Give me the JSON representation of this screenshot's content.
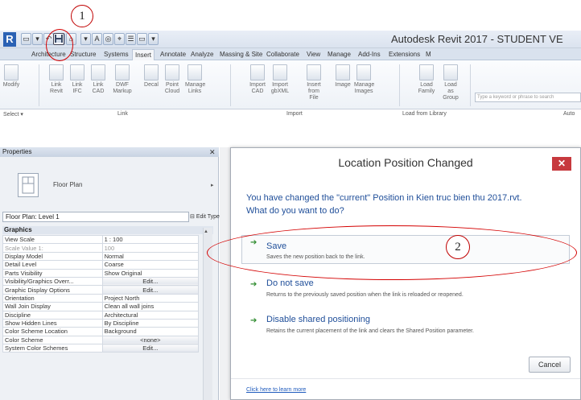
{
  "callouts": {
    "one": "1",
    "two": "2"
  },
  "app": {
    "logo": "R",
    "title": "Autodesk Revit 2017 - STUDENT VE"
  },
  "qat": [
    "▭",
    "▾",
    "↶",
    "↷",
    "⌂",
    "▾",
    "A",
    "◎",
    "⌖",
    "☰",
    "▭",
    "▾"
  ],
  "tabs": [
    "Architecture",
    "Structure",
    "Systems",
    "Insert",
    "Annotate",
    "Analyze",
    "Massing & Site",
    "Collaborate",
    "View",
    "Manage",
    "Add-Ins",
    "Extensions",
    "M"
  ],
  "active_tab": "Insert",
  "ribbon": {
    "buttons": [
      "Modify",
      "Link Revit",
      "Link IFC",
      "Link CAD",
      "DWF Markup",
      "Decal",
      "Point Cloud",
      "Manage Links",
      "Import CAD",
      "Import gbXML",
      "Insert from File",
      "Image",
      "Manage Images",
      "Load Family",
      "Load as Group"
    ],
    "panels": {
      "select": "Select ▾",
      "link": "Link",
      "import": "Import",
      "load_from_library": "Load from Library",
      "autodesk": "Auto"
    },
    "search_placeholder": "Type a keyword or phrase to search"
  },
  "properties": {
    "header": "Properties",
    "close": "✕",
    "type_name": "Floor Plan",
    "instance": "Floor Plan: Level 1",
    "edit_type": "Edit Type",
    "group": "Graphics",
    "rows": [
      {
        "name": "View Scale",
        "value": "1 : 100",
        "button": false
      },
      {
        "name": "Scale Value 1:",
        "value": "100",
        "button": false,
        "dim": true
      },
      {
        "name": "Display Model",
        "value": "Normal",
        "button": false
      },
      {
        "name": "Detail Level",
        "value": "Coarse",
        "button": false
      },
      {
        "name": "Parts Visibility",
        "value": "Show Original",
        "button": false
      },
      {
        "name": "Visibility/Graphics Overr...",
        "value": "Edit...",
        "button": true
      },
      {
        "name": "Graphic Display Options",
        "value": "Edit...",
        "button": true
      },
      {
        "name": "Orientation",
        "value": "Project North",
        "button": false
      },
      {
        "name": "Wall Join Display",
        "value": "Clean all wall joins",
        "button": false
      },
      {
        "name": "Discipline",
        "value": "Architectural",
        "button": false
      },
      {
        "name": "Show Hidden Lines",
        "value": "By Discipline",
        "button": false
      },
      {
        "name": "Color Scheme Location",
        "value": "Background",
        "button": false
      },
      {
        "name": "Color Scheme",
        "value": "<none>",
        "button": true
      },
      {
        "name": "System Color Schemes",
        "value": "Edit...",
        "button": true
      }
    ]
  },
  "dialog": {
    "title": "Location Position Changed",
    "close": "✕",
    "question_line1": "You have changed the \"current\" Position in Kien truc bien thu 2017.rvt.",
    "question_line2": "What do you want to do?",
    "options": [
      {
        "title": "Save",
        "desc": "Saves the new position back to the link."
      },
      {
        "title": "Do not save",
        "desc": "Returns to the previously saved position when the link is reloaded or reopened."
      },
      {
        "title": "Disable shared positioning",
        "desc": "Retains the current placement of the link and clears the Shared Position parameter."
      }
    ],
    "cancel": "Cancel",
    "learn_more": "Click here to learn more"
  }
}
